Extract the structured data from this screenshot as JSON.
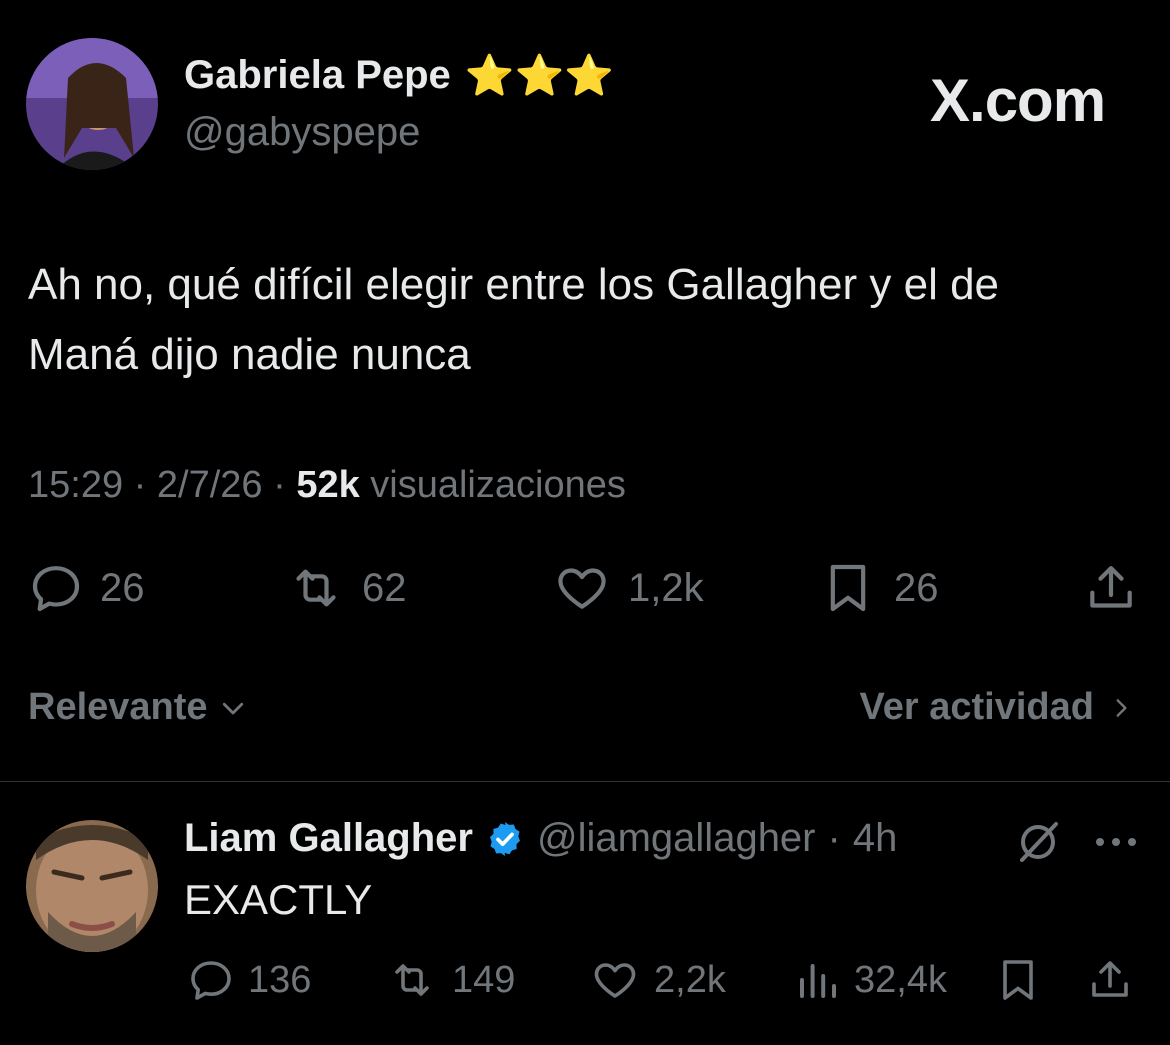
{
  "watermark": "X.com",
  "tweet": {
    "author_name": "Gabriela Pepe",
    "author_handle": "@gabyspepe",
    "author_emoji": "⭐⭐⭐",
    "text_line1": "Ah no, qué difícil elegir entre los Gallagher y el de",
    "text_line2": "Maná dijo nadie nunca",
    "time": "15:29",
    "date": "2/7/26",
    "views": "52k",
    "views_label": "visualizaciones",
    "replies": "26",
    "reposts": "62",
    "likes": "1,2k",
    "bookmarks": "26"
  },
  "sort": {
    "label": "Relevante",
    "activity_label": "Ver actividad"
  },
  "reply": {
    "author_name": "Liam Gallagher",
    "author_handle": "@liamgallagher",
    "age": "4h",
    "text": "EXACTLY",
    "replies": "136",
    "reposts": "149",
    "likes": "2,2k",
    "views": "32,4k"
  },
  "colors": {
    "background": "#000000",
    "text": "#e7e9ea",
    "muted": "#71767b",
    "verified": "#1d9bf0",
    "divider": "#2f3336"
  }
}
